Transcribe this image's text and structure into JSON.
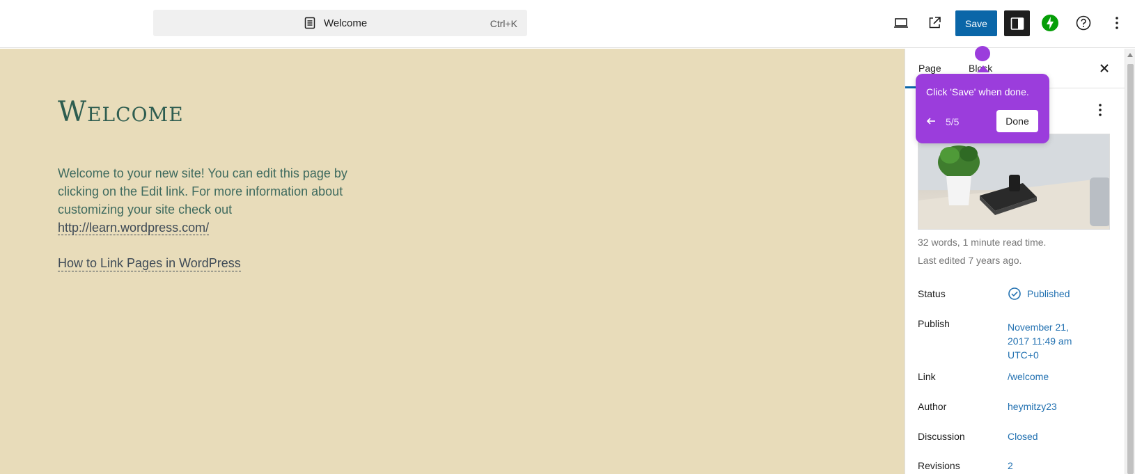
{
  "topbar": {
    "document_title": "Welcome",
    "shortcut": "Ctrl+K",
    "save_label": "Save",
    "icons": [
      "desktop-preview-icon",
      "external-link-icon",
      "sidebar-toggle-icon",
      "jetpack-icon",
      "help-icon",
      "more-vertical-icon"
    ]
  },
  "canvas": {
    "title": "Welcome",
    "paragraph_text": "Welcome to your new site! You can edit this page by clicking on the Edit link. For more information about customizing your site check out ",
    "paragraph_link": "http://learn.wordpress.com/",
    "link2": "How to Link Pages in WordPress"
  },
  "sidebar": {
    "tabs": [
      {
        "label": "Page"
      },
      {
        "label": "Block"
      }
    ],
    "word_count": "32 words, 1 minute read time.",
    "last_edited": "Last edited 7 years ago.",
    "rows": [
      {
        "label": "Status",
        "value": "Published"
      },
      {
        "label": "Publish",
        "value": "November 21, 2017 11:49 am UTC+0"
      },
      {
        "label": "Link",
        "value": "/welcome"
      },
      {
        "label": "Author",
        "value": "heymitzy23"
      },
      {
        "label": "Discussion",
        "value": "Closed"
      },
      {
        "label": "Revisions",
        "value": "2"
      }
    ]
  },
  "tour": {
    "message": "Click 'Save' when done.",
    "step": "5/5",
    "done_label": "Done"
  },
  "colors": {
    "accent": "#0a66a8",
    "tour": "#9b3ddc",
    "canvas_bg": "#e8dcba",
    "title_color": "#2e5d50",
    "jetpack": "#069e08"
  }
}
